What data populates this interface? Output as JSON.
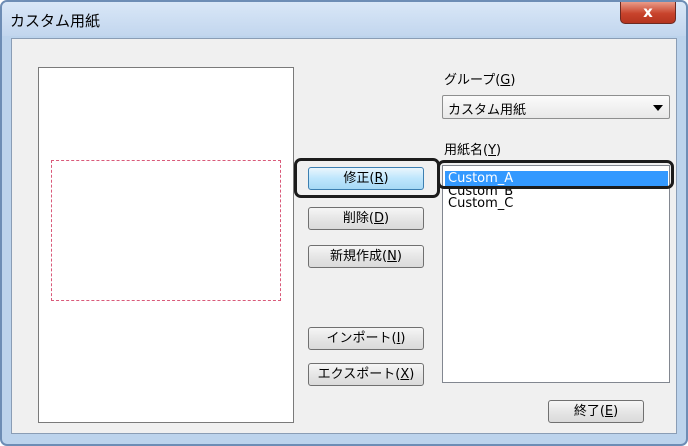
{
  "window": {
    "title": "カスタム用紙",
    "close_label": "x"
  },
  "buttons": {
    "modify": {
      "text": "修正(",
      "key": "R",
      "tail": ")"
    },
    "delete": {
      "text": "削除(",
      "key": "D",
      "tail": ")"
    },
    "new": {
      "text": "新規作成(",
      "key": "N",
      "tail": ")"
    },
    "import": {
      "text": "インポート(",
      "key": "I",
      "tail": ")"
    },
    "export": {
      "text": "エクスポート(",
      "key": "X",
      "tail": ")"
    },
    "exit": {
      "text": "終了(",
      "key": "E",
      "tail": ")"
    }
  },
  "group": {
    "label_text": "グループ(",
    "key": "G",
    "tail": ")",
    "selected": "カスタム用紙"
  },
  "paper_names": {
    "label_text": "用紙名(",
    "key": "Y",
    "tail": ")",
    "items": [
      "Custom_A",
      "Custom_B",
      "Custom_C"
    ],
    "selected_index": 0
  },
  "colors": {
    "selection": "#3399ff",
    "paper_outline": "#d95a7a",
    "highlight_ring": "#1c1c1c"
  }
}
